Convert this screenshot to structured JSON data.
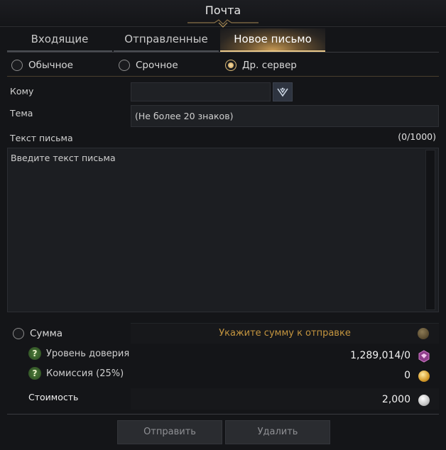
{
  "window": {
    "title": "Почта"
  },
  "tabs": [
    {
      "label": "Входящие"
    },
    {
      "label": "Отправленные"
    },
    {
      "label": "Новое письмо"
    }
  ],
  "mail_type": {
    "options": [
      "Обычное",
      "Срочное",
      "Др. сервер"
    ],
    "selected": "Др. сервер"
  },
  "form": {
    "to_label": "Кому",
    "to_value": "",
    "subject_label": "Тема",
    "subject_placeholder": "(Не более 20 знаков)",
    "body_label": "Текст письма",
    "body_counter": "(0/1000)",
    "body_placeholder": "Введите текст письма"
  },
  "amount": {
    "label": "Сумма",
    "placeholder": "Укажите сумму к отправке"
  },
  "trust": {
    "label": "Уровень доверия",
    "value": "1,289,014/0"
  },
  "commission": {
    "label": "Комиссия (25%)",
    "value": "0"
  },
  "cost": {
    "label": "Стоимость",
    "value": "2,000"
  },
  "buttons": {
    "send": "Отправить",
    "delete": "Удалить"
  },
  "colors": {
    "accent_gold": "#e9c88a",
    "placeholder_gold": "#c4953f"
  }
}
